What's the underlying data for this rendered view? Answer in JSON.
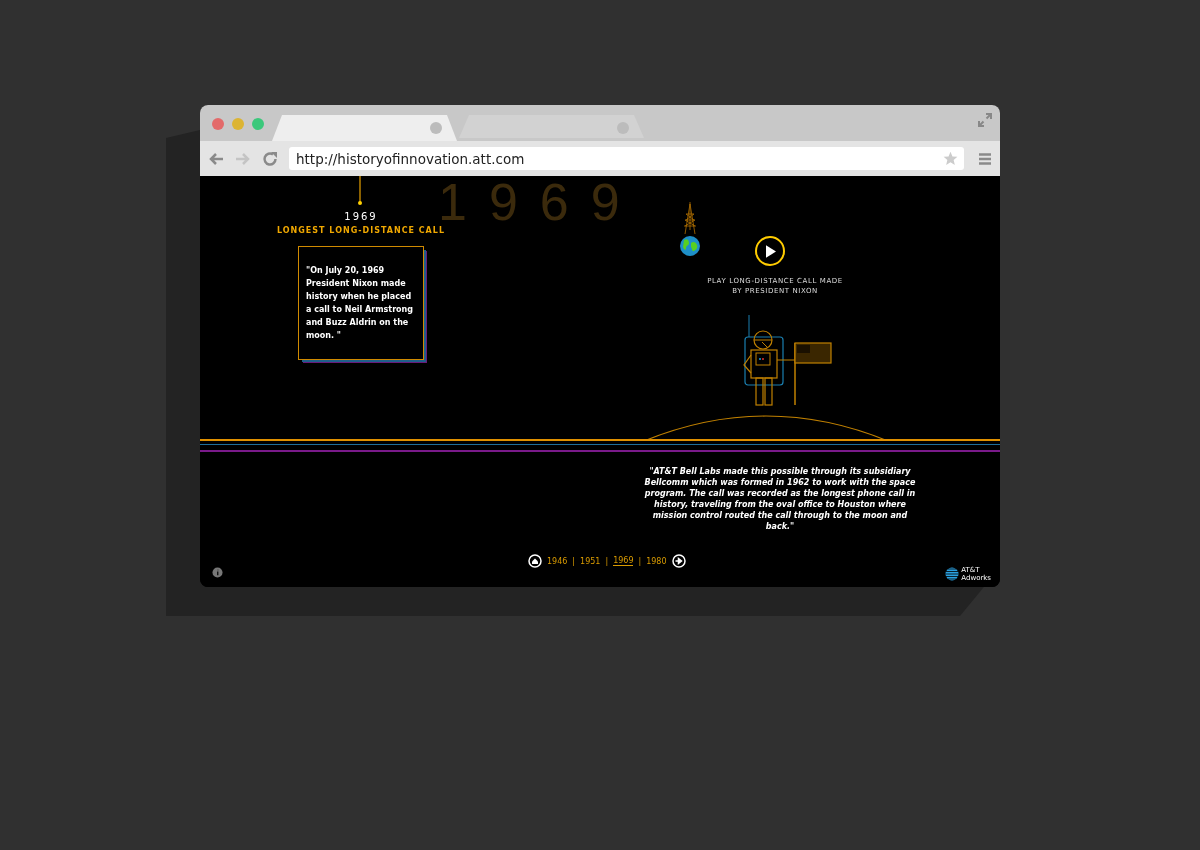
{
  "browser": {
    "tabs": [
      {
        "selected": true
      },
      {
        "selected": false
      }
    ],
    "address": "http://historyofinnovation.att.com"
  },
  "page": {
    "background_year": "1969",
    "milestone": {
      "year": "1969",
      "title": "LONGEST LONG-DISTANCE CALL",
      "quote": "\"On July 20, 1969 President Nixon made history when he placed a call to Neil Armstrong and Buzz Aldrin on the moon. \""
    },
    "play_caption": [
      "PLAY LONG-DISTANCE CALL MADE",
      "BY PRESIDENT NIXON"
    ],
    "description": "\"AT&T Bell Labs made this possible through its subsidiary Bellcomm which was formed in 1962 to work with the space program. The call was recorded as the longest phone call in history, traveling from the oval office to Houston where mission control routed the call through to the moon and back.\"",
    "timeline_separator": "|",
    "timeline": [
      {
        "label": "1946",
        "selected": false
      },
      {
        "label": "1951",
        "selected": false
      },
      {
        "label": "1969",
        "selected": true
      },
      {
        "label": "1980",
        "selected": false
      }
    ],
    "logo": {
      "name": "AT&T",
      "sub": "Adworks"
    }
  }
}
